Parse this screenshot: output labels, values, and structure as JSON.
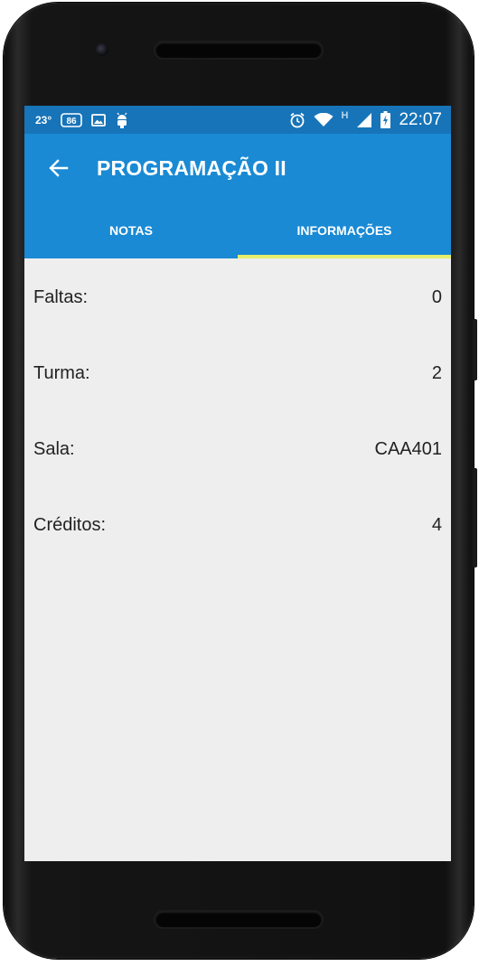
{
  "status_bar": {
    "temperature": "23°",
    "network_badge": "86",
    "network_type": "H",
    "time": "22:07",
    "icons": [
      "weather-badge",
      "image-icon",
      "android-debug-icon",
      "alarm-icon",
      "wifi-icon",
      "cell-signal-icon",
      "battery-charging-icon"
    ]
  },
  "app_bar": {
    "title": "PROGRAMAÇÃO II",
    "back_icon": "arrow-back-icon",
    "color": "#1a8ad4"
  },
  "tabs": [
    {
      "label": "NOTAS",
      "active": false
    },
    {
      "label": "INFORMAÇÕES",
      "active": true
    }
  ],
  "info": [
    {
      "label": "Faltas:",
      "value": "0"
    },
    {
      "label": "Turma:",
      "value": "2"
    },
    {
      "label": "Sala:",
      "value": "CAA401"
    },
    {
      "label": "Créditos:",
      "value": "4"
    }
  ],
  "colors": {
    "status_bar": "#1774b8",
    "app_bar": "#1a8ad4",
    "tab_indicator": "#e6ee6c",
    "background": "#eeeeee"
  }
}
